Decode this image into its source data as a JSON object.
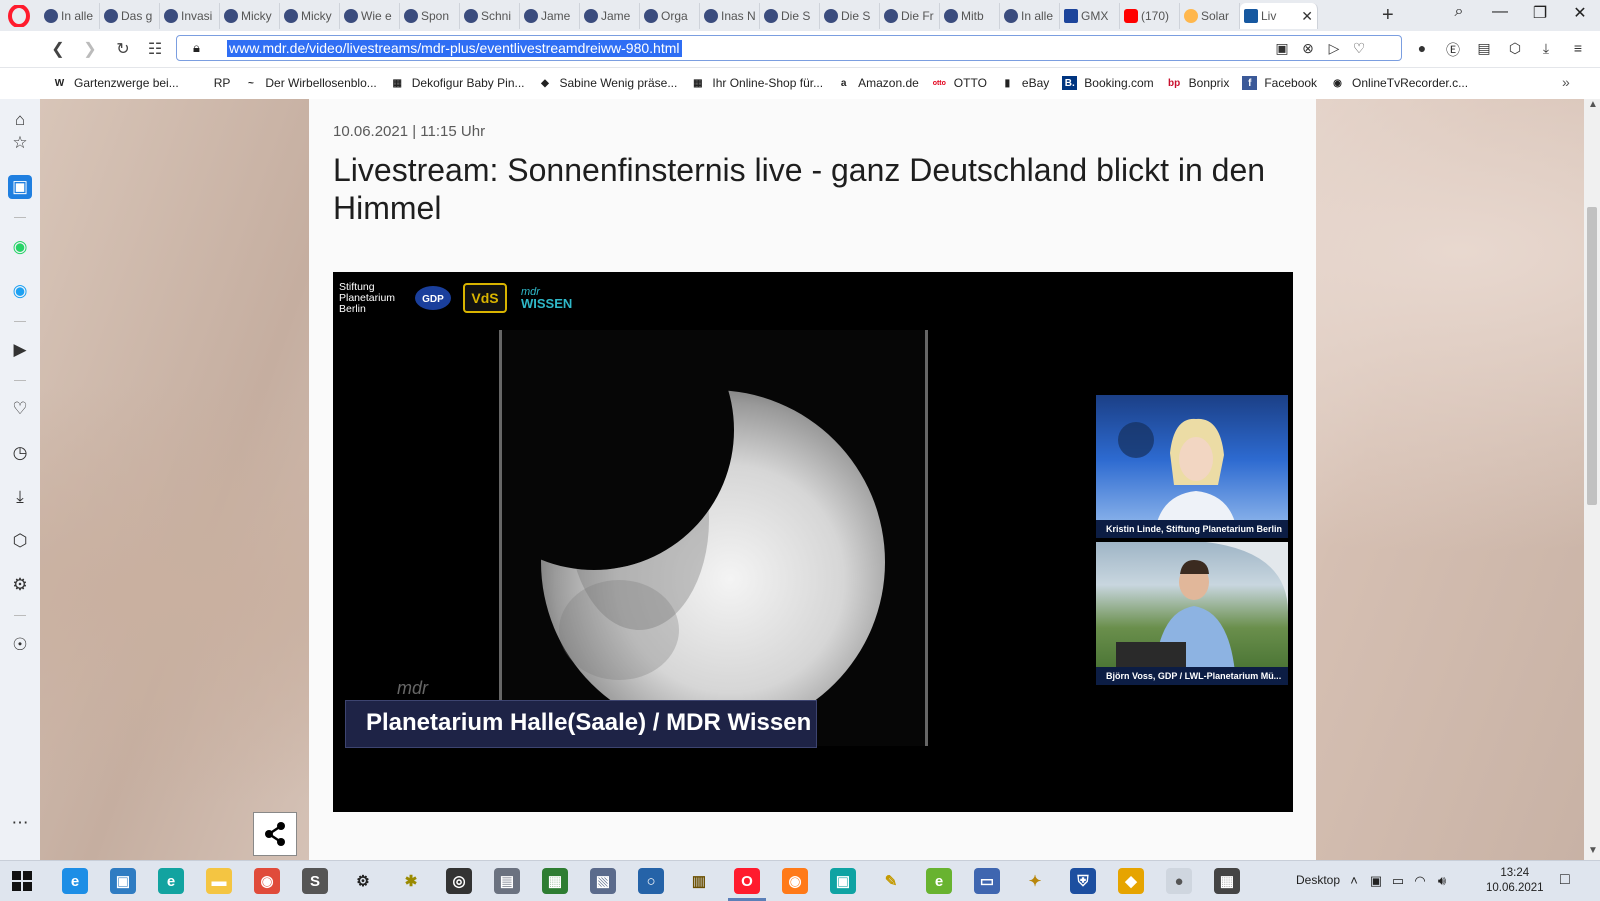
{
  "browser": {
    "tabs": [
      {
        "label": "In alle",
        "icon": "info-icon"
      },
      {
        "label": "Das g",
        "icon": "web-icon"
      },
      {
        "label": "Invasi",
        "icon": "web-icon"
      },
      {
        "label": "Micky",
        "icon": "web-icon"
      },
      {
        "label": "Micky",
        "icon": "web-icon"
      },
      {
        "label": "Wie e",
        "icon": "web-icon"
      },
      {
        "label": "Spon",
        "icon": "web-icon"
      },
      {
        "label": "Schni",
        "icon": "web-icon"
      },
      {
        "label": "Jame",
        "icon": "web-icon"
      },
      {
        "label": "Jame",
        "icon": "web-icon"
      },
      {
        "label": "Orga",
        "icon": "web-icon"
      },
      {
        "label": "Inas N",
        "icon": "web-icon"
      },
      {
        "label": "Die S",
        "icon": "web-icon"
      },
      {
        "label": "Die S",
        "icon": "web-icon"
      },
      {
        "label": "Die Fr",
        "icon": "web-icon"
      },
      {
        "label": "Mitb",
        "icon": "web-icon"
      },
      {
        "label": "In alle",
        "icon": "web-icon"
      },
      {
        "label": "GMX",
        "icon": "gmx-icon"
      },
      {
        "label": "(170)",
        "icon": "youtube-icon"
      },
      {
        "label": "Solar",
        "icon": "solar-icon"
      },
      {
        "label": "Liv",
        "icon": "mdr-icon",
        "active": true
      }
    ],
    "url": "www.mdr.de/video/livestreams/mdr-plus/eventlivestreamdreiww-980.html",
    "bookmarks": [
      {
        "label": "Gartenzwerge bei...",
        "icon": "W"
      },
      {
        "label": "RP",
        "icon": ""
      },
      {
        "label": "Der Wirbellosenblo...",
        "icon": "~"
      },
      {
        "label": "Dekofigur Baby Pin...",
        "icon": "▦"
      },
      {
        "label": "Sabine Wenig präse...",
        "icon": "◆"
      },
      {
        "label": "Ihr Online-Shop für...",
        "icon": "▦"
      },
      {
        "label": "Amazon.de",
        "icon": "a"
      },
      {
        "label": "OTTO",
        "icon": "otto"
      },
      {
        "label": "eBay",
        "icon": "▮"
      },
      {
        "label": "Booking.com",
        "icon": "B."
      },
      {
        "label": "Bonprix",
        "icon": "bp"
      },
      {
        "label": "Facebook",
        "icon": "f"
      },
      {
        "label": "OnlineTvRecorder.c...",
        "icon": "◉"
      }
    ]
  },
  "article": {
    "date": "10.06.2021 | 11:15 Uhr",
    "title": "Livestream: Sonnenfinsternis live - ganz Deutschland blickt in den Himmel",
    "video": {
      "logo_text": "Stiftung Planetarium Berlin",
      "gdp_logo": "GDP",
      "vds_logo": "VdS",
      "mdr_logo": "mdr",
      "wissen_logo": "WISSEN",
      "watermark": "mdr",
      "lower_third": "Planetarium Halle(Saale) / MDR Wissen",
      "cam1_caption": "Kristin Linde, Stiftung Planetarium Berlin",
      "cam2_caption": "Björn Voss, GDP / LWL-Planetarium Mü..."
    }
  },
  "taskbar": {
    "desktop_label": "Desktop",
    "time": "13:24",
    "date": "10.06.2021"
  },
  "colors": {
    "accent": "#1f7fe0",
    "url_highlight": "#2f6ef4",
    "opera_red": "#ff1b2d",
    "video_caption_bg": "#1e2346"
  }
}
